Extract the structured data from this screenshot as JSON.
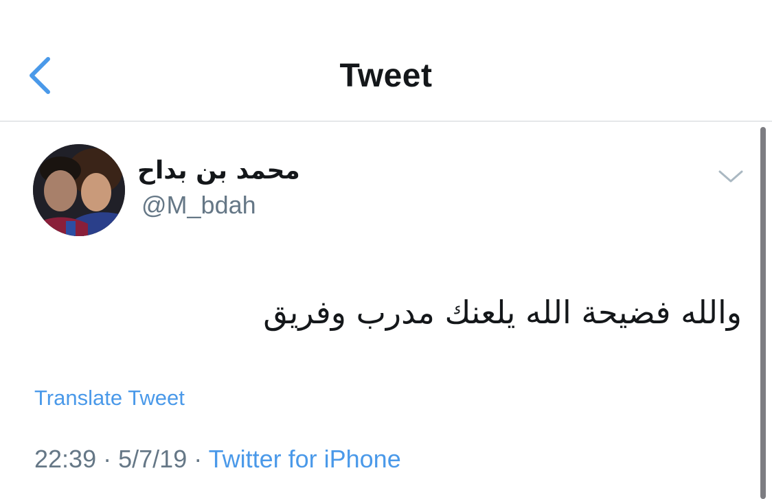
{
  "header": {
    "title": "Tweet",
    "back_icon": "chevron-left-icon"
  },
  "tweet": {
    "author": {
      "display_name": "محمد بن بداح",
      "handle": "@M_bdah",
      "avatar": "profile-photo"
    },
    "menu_icon": "chevron-down-icon",
    "text": "والله فضيحة الله يلعنك مدرب وفريق",
    "translate_label": "Translate Tweet",
    "time": "22:39",
    "separator": "·",
    "date": "5/7/19",
    "source": "Twitter for iPhone"
  },
  "colors": {
    "accent": "#4a99e9",
    "text_primary": "#14171a",
    "text_secondary": "#657786",
    "divider": "#cfd3d7"
  }
}
